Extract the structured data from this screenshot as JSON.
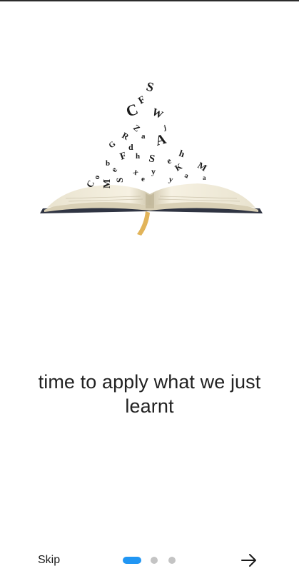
{
  "onboarding": {
    "headline": "time to apply what we just learnt",
    "illustration_icon": "open-book-flying-letters-icon",
    "letters": [
      "S",
      "F",
      "C",
      "A",
      "W",
      "Z",
      "M",
      "R",
      "G",
      "A",
      "h",
      "d",
      "a",
      "b",
      "S",
      "x",
      "K",
      "e",
      "y",
      "j"
    ]
  },
  "footer": {
    "skip_label": "Skip",
    "page_count": 3,
    "current_page": 1,
    "next_icon": "arrow-right-icon",
    "active_dot_color": "#2196f3",
    "inactive_dot_color": "#c4c4c4"
  }
}
